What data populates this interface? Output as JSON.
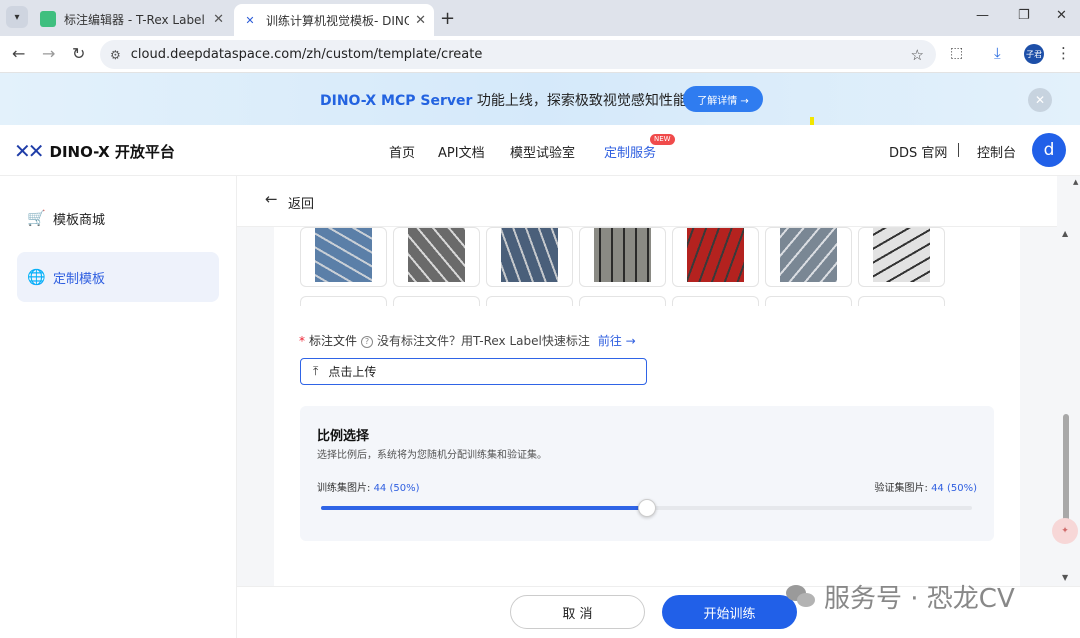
{
  "browser": {
    "tabs": [
      {
        "title": "标注编辑器 - T-Rex Label",
        "active": false
      },
      {
        "title": "训练计算机视觉模板- DINO-X",
        "active": true
      }
    ],
    "url": "cloud.deepdataspace.com/zh/custom/template/create",
    "profile_label": "子君"
  },
  "banner": {
    "highlight": "DINO-X MCP Server",
    "text": " 功能上线，探索极致视觉感知性能",
    "button": "了解详情 →"
  },
  "header": {
    "brand": "DINO-X 开放平台",
    "nav": [
      "首页",
      "API文档",
      "模型试验室",
      "定制服务"
    ],
    "new_badge": "NEW",
    "right_links": [
      "DDS 官网",
      "控制台"
    ],
    "avatar": "d"
  },
  "sidebar": {
    "items": [
      {
        "label": "模板商城",
        "icon": "cart-icon"
      },
      {
        "label": "定制模板",
        "icon": "globe-icon",
        "active": true
      }
    ]
  },
  "main": {
    "back": "返回",
    "thumbnails": [
      {
        "bg": "#5b7fa8",
        "fg": "#c9cfd6"
      },
      {
        "bg": "#6a6a6a",
        "fg": "#d8d8d8"
      },
      {
        "bg": "#4a5f7a",
        "fg": "#c5c8cc"
      },
      {
        "bg": "#8a8a84",
        "fg": "#2a2a2a"
      },
      {
        "bg": "#b4221f",
        "fg": "#3a3a3a"
      },
      {
        "bg": "#7a8794",
        "fg": "#dadde2"
      },
      {
        "bg": "#e2e2e2",
        "fg": "#333333"
      }
    ],
    "annotation": {
      "label": "标注文件",
      "hint": "没有标注文件？用T-Rex Label快速标注",
      "link": "前往 →",
      "upload": "点击上传"
    },
    "ratio": {
      "title": "比例选择",
      "desc": "选择比例后，系统将为您随机分配训练集和验证集。",
      "train_label": "训练集图片:",
      "train_value": "44 (50%)",
      "val_label": "验证集图片:",
      "val_value": "44 (50%)",
      "percent": 50
    },
    "footer": {
      "cancel": "取 消",
      "start": "开始训练"
    }
  },
  "watermark": "服务号 · 恐龙CV"
}
